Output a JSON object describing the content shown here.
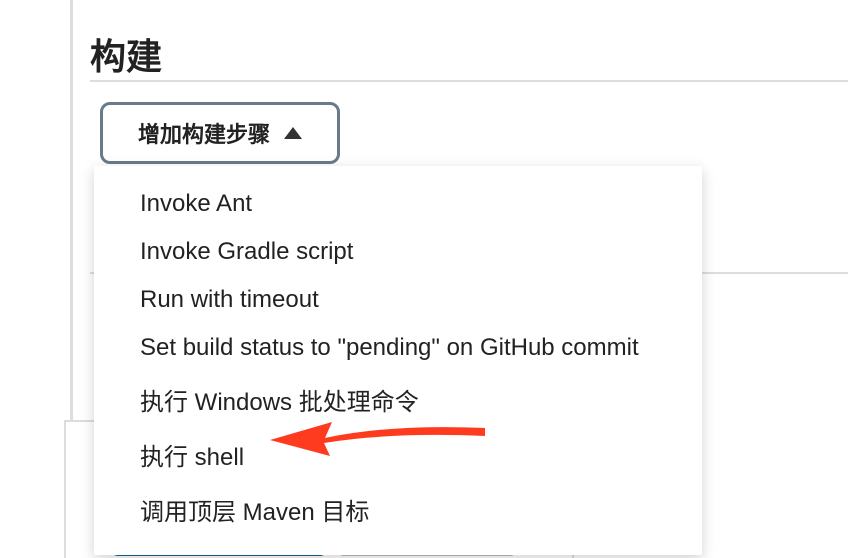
{
  "section": {
    "title": "构建"
  },
  "dropdown": {
    "button_label": "增加构建步骤",
    "items": [
      "Invoke Ant",
      "Invoke Gradle script",
      "Run with timeout",
      "Set build status to \"pending\" on GitHub commit",
      "执行 Windows 批处理命令",
      "执行 shell",
      "调用顶层 Maven 目标"
    ]
  }
}
